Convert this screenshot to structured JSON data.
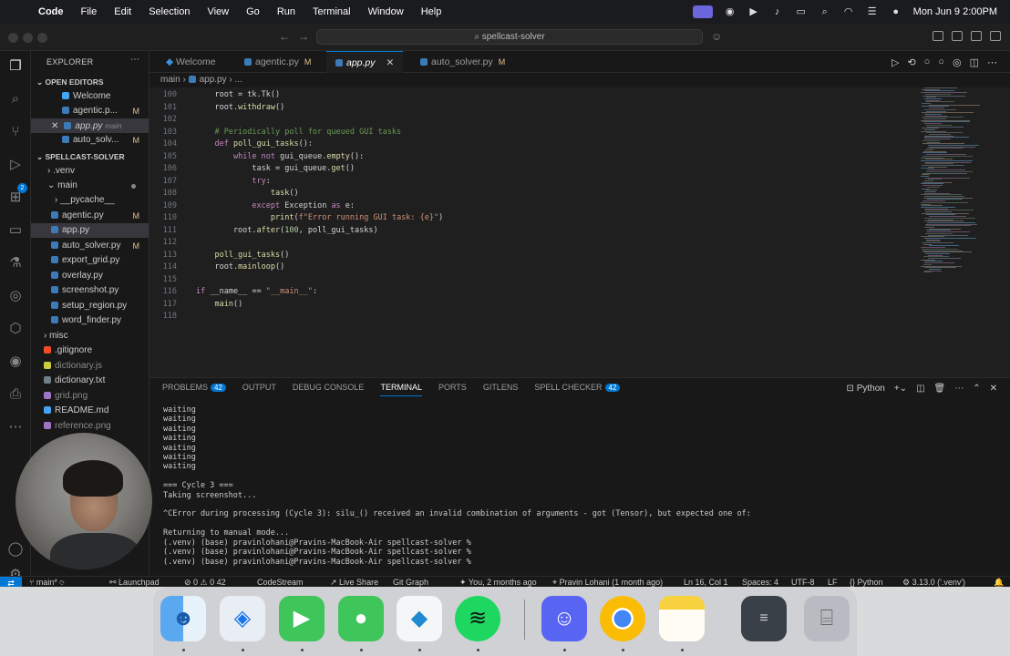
{
  "menubar": {
    "app": "Code",
    "items": [
      "File",
      "Edit",
      "Selection",
      "View",
      "Go",
      "Run",
      "Terminal",
      "Window",
      "Help"
    ],
    "clock": "Mon Jun 9  2:00PM"
  },
  "titlebar": {
    "search": "spellcast-solver"
  },
  "explorer": {
    "title": "EXPLORER",
    "open_editors_label": "OPEN EDITORS",
    "open_editors": [
      {
        "name": "Welcome",
        "mod": ""
      },
      {
        "name": "agentic.p...",
        "mod": "M"
      },
      {
        "name": "app.py",
        "mod": "",
        "extra": "main"
      },
      {
        "name": "auto_solv...",
        "mod": "M"
      }
    ],
    "project_label": "SPELLCAST-SOLVER",
    "tree": [
      {
        "name": ".venv",
        "mod": ""
      },
      {
        "name": "main",
        "mod": ""
      },
      {
        "name": "__pycache__",
        "mod": ""
      },
      {
        "name": "agentic.py",
        "mod": "M"
      },
      {
        "name": "app.py",
        "mod": ""
      },
      {
        "name": "auto_solver.py",
        "mod": "M"
      },
      {
        "name": "export_grid.py",
        "mod": ""
      },
      {
        "name": "overlay.py",
        "mod": ""
      },
      {
        "name": "screenshot.py",
        "mod": ""
      },
      {
        "name": "setup_region.py",
        "mod": ""
      },
      {
        "name": "word_finder.py",
        "mod": ""
      },
      {
        "name": "misc",
        "mod": ""
      },
      {
        "name": ".gitignore",
        "mod": ""
      },
      {
        "name": "dictionary.js",
        "mod": ""
      },
      {
        "name": "dictionary.txt",
        "mod": ""
      },
      {
        "name": "grid.png",
        "mod": ""
      },
      {
        "name": "README.md",
        "mod": ""
      },
      {
        "name": "reference.png",
        "mod": ""
      }
    ]
  },
  "tabs": [
    {
      "label": "Welcome",
      "mod": ""
    },
    {
      "label": "agentic.py",
      "mod": "M"
    },
    {
      "label": "app.py",
      "mod": ""
    },
    {
      "label": "auto_solver.py",
      "mod": "M"
    }
  ],
  "breadcrumb": {
    "folder": "main",
    "file": "app.py",
    "more": "..."
  },
  "editor": {
    "line_numbers": [
      "100",
      "101",
      "102",
      "103",
      "104",
      "105",
      "106",
      "107",
      "108",
      "109",
      "110",
      "111",
      "112",
      "113",
      "114",
      "115",
      "116",
      "117",
      "118"
    ],
    "lines": [
      "    root = tk.Tk()",
      "    root.withdraw()",
      "",
      "    # Periodically poll for queued GUI tasks",
      "    def poll_gui_tasks():",
      "        while not gui_queue.empty():",
      "            task = gui_queue.get()",
      "            try:",
      "                task()",
      "            except Exception as e:",
      "                print(f\"Error running GUI task: {e}\")",
      "        root.after(100, poll_gui_tasks)",
      "",
      "    poll_gui_tasks()",
      "    root.mainloop()",
      "",
      "if __name__ == \"__main__\":",
      "    main()",
      ""
    ]
  },
  "panel": {
    "tabs": [
      {
        "label": "PROBLEMS",
        "badge": "42"
      },
      {
        "label": "OUTPUT",
        "badge": ""
      },
      {
        "label": "DEBUG CONSOLE",
        "badge": ""
      },
      {
        "label": "TERMINAL",
        "badge": ""
      },
      {
        "label": "PORTS",
        "badge": ""
      },
      {
        "label": "GITLENS",
        "badge": ""
      },
      {
        "label": "SPELL CHECKER",
        "badge": "42"
      }
    ],
    "shell": "Python",
    "terminal_lines": [
      "waiting",
      "waiting",
      "waiting",
      "waiting",
      "waiting",
      "waiting",
      "waiting",
      "",
      "=== Cycle 3 ===",
      "Taking screenshot...",
      "",
      "^CError during processing (Cycle 3): silu_() received an invalid combination of arguments - got (Tensor), but expected one of:",
      "",
      "Returning to manual mode...",
      "(.venv) (base) pravinlohani@Pravins-MacBook-Air spellcast-solver %",
      "(.venv) (base) pravinlohani@Pravins-MacBook-Air spellcast-solver %",
      "(.venv) (base) pravinlohani@Pravins-MacBook-Air spellcast-solver % "
    ]
  },
  "statusbar": {
    "branch": "main*",
    "launchpad": "Launchpad",
    "problems": "⊘ 0 ⚠ 0 42",
    "codestream": "CodeStream",
    "liveshare": "Live Share",
    "gitgraph": "Git Graph",
    "blame": "You, 2 months ago",
    "author": "Pravin Lohani (1 month ago)",
    "position": "Ln 16, Col 1",
    "spaces": "Spaces: 4",
    "encoding": "UTF-8",
    "eol": "LF",
    "language": "Python",
    "interpreter": "3.13.0 ('.venv')"
  },
  "dock": [
    "finder-icon",
    "safari-icon",
    "facetime-icon",
    "messages-icon",
    "vscode-icon",
    "spotify-icon",
    "discord-icon",
    "chrome-icon",
    "notes-icon",
    "preview-icon",
    "trash-icon"
  ],
  "colors": {
    "accent": "#0078d4",
    "modified": "#e2c08d",
    "keyword": "#c586c0",
    "function": "#dcdcaa",
    "string": "#ce9178",
    "comment": "#6a9955"
  }
}
